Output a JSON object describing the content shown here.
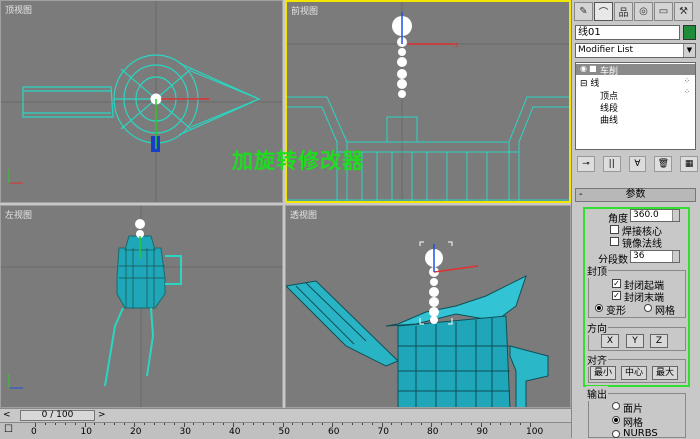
{
  "viewports": {
    "top": "顶视图",
    "front": "前视图",
    "left": "左视图",
    "perspective": "透视图"
  },
  "overlay_title": "加旋转修改器",
  "command_panel": {
    "object_name": "线01",
    "object_color": "#1e8c3a",
    "modifier_list": "Modifier List",
    "stack": {
      "modifier": "车削",
      "base": "线",
      "subobjects": [
        "顶点",
        "线段",
        "曲线"
      ]
    },
    "rollout_title": "参数",
    "angle_label": "角度",
    "angle_value": "360.0",
    "weld_core": "焊接核心",
    "flip_normals": "镜像法线",
    "segments_label": "分段数",
    "segments_value": "36",
    "capping": {
      "label": "封顶",
      "cap_start": "封闭起端",
      "cap_end": "封闭末端",
      "morph": "变形",
      "grid": "网格"
    },
    "direction": {
      "label": "方向",
      "x": "X",
      "y": "Y",
      "z": "Z"
    },
    "align": {
      "label": "对齐",
      "min": "最小",
      "center": "中心",
      "max": "最大"
    },
    "output": {
      "label": "输出",
      "patch": "面片",
      "mesh": "网格",
      "nurbs": "NURBS"
    }
  },
  "timeline": {
    "frame_display": "0 / 100",
    "ticks": [
      "0",
      "10",
      "20",
      "30",
      "40",
      "50",
      "60",
      "70",
      "80",
      "90",
      "100"
    ]
  }
}
